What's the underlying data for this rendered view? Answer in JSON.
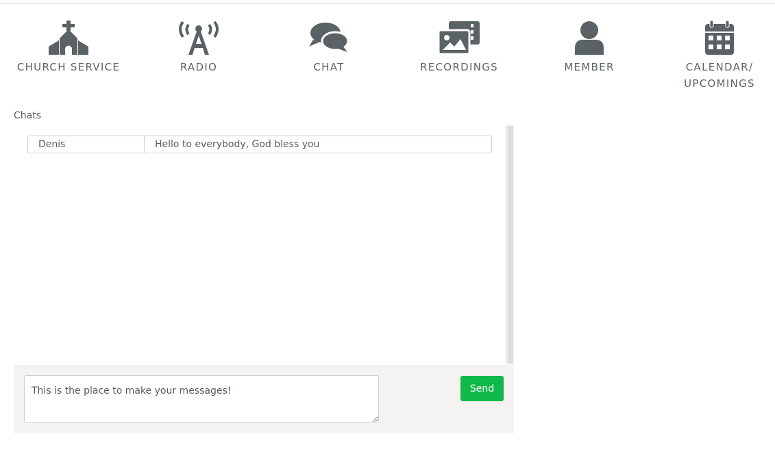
{
  "nav": {
    "items": [
      {
        "label": "CHURCH SERVICE",
        "icon": "church-icon"
      },
      {
        "label": "RADIO",
        "icon": "radio-tower-icon"
      },
      {
        "label": "CHAT",
        "icon": "chat-bubbles-icon"
      },
      {
        "label": "RECORDINGS",
        "icon": "images-icon"
      },
      {
        "label": "MEMBER",
        "icon": "user-icon"
      },
      {
        "label": "CALENDAR/\nUPCOMINGS",
        "icon": "calendar-icon"
      }
    ]
  },
  "chat": {
    "heading": "Chats",
    "messages": [
      {
        "author": "Denis",
        "text": "Hello to everybody, God bless you"
      }
    ],
    "input_placeholder": "This is the place to make your messages!",
    "send_label": "Send"
  },
  "colors": {
    "icon": "#5b6266",
    "send_button": "#0fba4a",
    "composer_bg": "#f4f3f1"
  }
}
